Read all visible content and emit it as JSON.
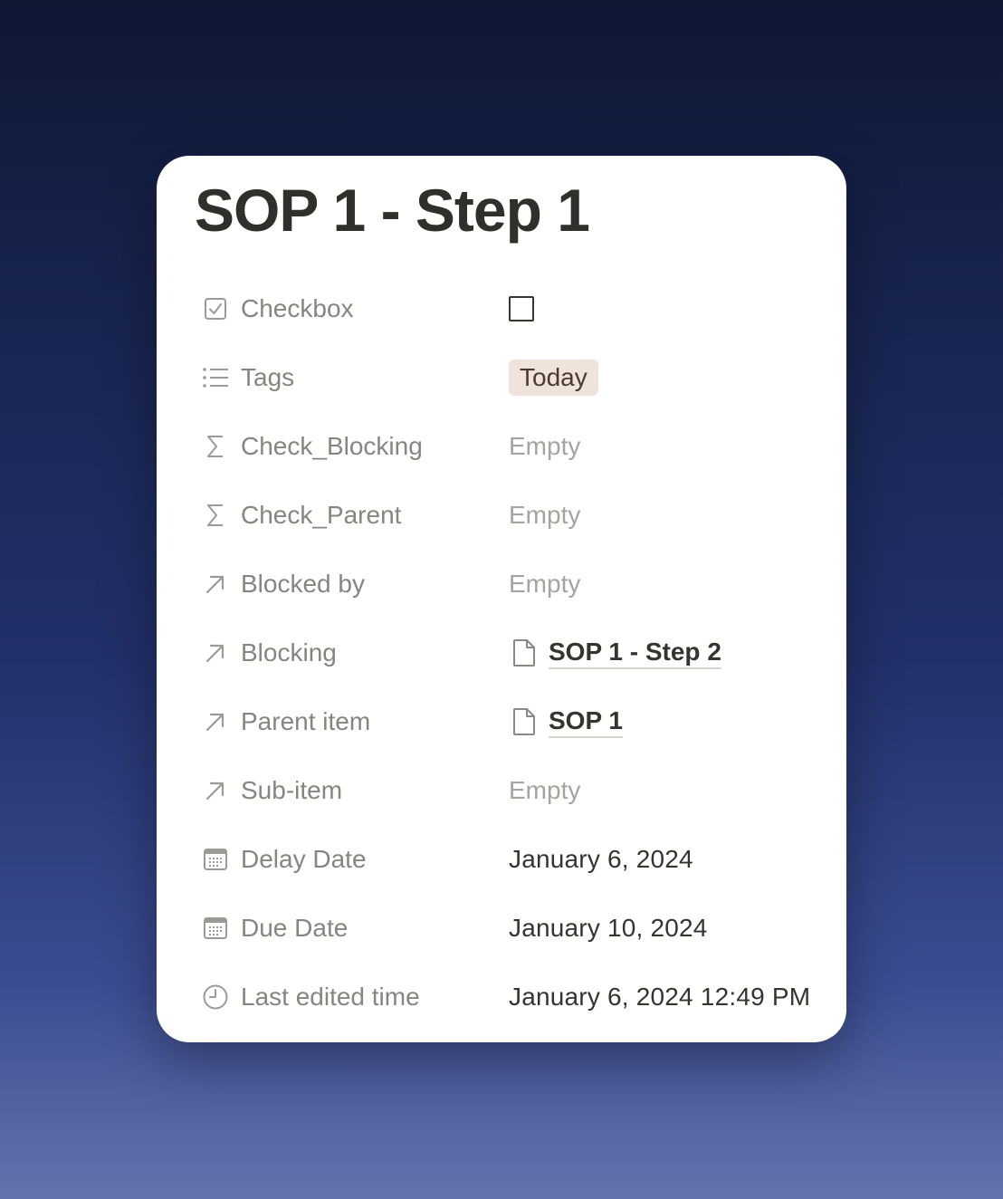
{
  "page": {
    "title": "SOP 1 - Step 1"
  },
  "properties": [
    {
      "label": "Checkbox",
      "icon": "checkbox-icon",
      "type": "checkbox",
      "checked": false
    },
    {
      "label": "Tags",
      "icon": "list-icon",
      "type": "tag",
      "value": "Today",
      "tag_color": "#efe3dc"
    },
    {
      "label": "Check_Blocking",
      "icon": "sigma-icon",
      "type": "empty",
      "value": "Empty"
    },
    {
      "label": "Check_Parent",
      "icon": "sigma-icon",
      "type": "empty",
      "value": "Empty"
    },
    {
      "label": "Blocked by",
      "icon": "arrow-up-right-icon",
      "type": "empty",
      "value": "Empty"
    },
    {
      "label": "Blocking",
      "icon": "arrow-up-right-icon",
      "type": "relation",
      "value": "SOP 1 - Step 2",
      "value_icon": "document-icon"
    },
    {
      "label": "Parent item",
      "icon": "arrow-up-right-icon",
      "type": "relation",
      "value": "SOP 1",
      "value_icon": "document-icon"
    },
    {
      "label": "Sub-item",
      "icon": "arrow-up-right-icon",
      "type": "empty",
      "value": "Empty"
    },
    {
      "label": "Delay Date",
      "icon": "calendar-icon",
      "type": "text",
      "value": "January 6, 2024"
    },
    {
      "label": "Due Date",
      "icon": "calendar-icon",
      "type": "text",
      "value": "January 10, 2024"
    },
    {
      "label": "Last edited time",
      "icon": "clock-icon",
      "type": "text",
      "value": "January 6, 2024 12:49 PM"
    }
  ]
}
